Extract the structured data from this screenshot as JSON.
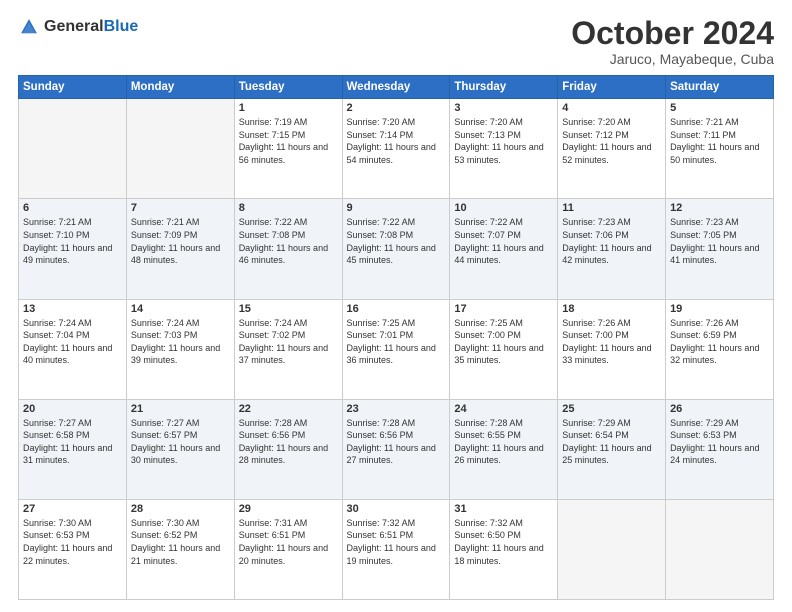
{
  "logo": {
    "general": "General",
    "blue": "Blue"
  },
  "title": "October 2024",
  "location": "Jaruco, Mayabeque, Cuba",
  "weekdays": [
    "Sunday",
    "Monday",
    "Tuesday",
    "Wednesday",
    "Thursday",
    "Friday",
    "Saturday"
  ],
  "weeks": [
    [
      {
        "day": "",
        "sunrise": "",
        "sunset": "",
        "daylight": ""
      },
      {
        "day": "",
        "sunrise": "",
        "sunset": "",
        "daylight": ""
      },
      {
        "day": "1",
        "sunrise": "Sunrise: 7:19 AM",
        "sunset": "Sunset: 7:15 PM",
        "daylight": "Daylight: 11 hours and 56 minutes."
      },
      {
        "day": "2",
        "sunrise": "Sunrise: 7:20 AM",
        "sunset": "Sunset: 7:14 PM",
        "daylight": "Daylight: 11 hours and 54 minutes."
      },
      {
        "day": "3",
        "sunrise": "Sunrise: 7:20 AM",
        "sunset": "Sunset: 7:13 PM",
        "daylight": "Daylight: 11 hours and 53 minutes."
      },
      {
        "day": "4",
        "sunrise": "Sunrise: 7:20 AM",
        "sunset": "Sunset: 7:12 PM",
        "daylight": "Daylight: 11 hours and 52 minutes."
      },
      {
        "day": "5",
        "sunrise": "Sunrise: 7:21 AM",
        "sunset": "Sunset: 7:11 PM",
        "daylight": "Daylight: 11 hours and 50 minutes."
      }
    ],
    [
      {
        "day": "6",
        "sunrise": "Sunrise: 7:21 AM",
        "sunset": "Sunset: 7:10 PM",
        "daylight": "Daylight: 11 hours and 49 minutes."
      },
      {
        "day": "7",
        "sunrise": "Sunrise: 7:21 AM",
        "sunset": "Sunset: 7:09 PM",
        "daylight": "Daylight: 11 hours and 48 minutes."
      },
      {
        "day": "8",
        "sunrise": "Sunrise: 7:22 AM",
        "sunset": "Sunset: 7:08 PM",
        "daylight": "Daylight: 11 hours and 46 minutes."
      },
      {
        "day": "9",
        "sunrise": "Sunrise: 7:22 AM",
        "sunset": "Sunset: 7:08 PM",
        "daylight": "Daylight: 11 hours and 45 minutes."
      },
      {
        "day": "10",
        "sunrise": "Sunrise: 7:22 AM",
        "sunset": "Sunset: 7:07 PM",
        "daylight": "Daylight: 11 hours and 44 minutes."
      },
      {
        "day": "11",
        "sunrise": "Sunrise: 7:23 AM",
        "sunset": "Sunset: 7:06 PM",
        "daylight": "Daylight: 11 hours and 42 minutes."
      },
      {
        "day": "12",
        "sunrise": "Sunrise: 7:23 AM",
        "sunset": "Sunset: 7:05 PM",
        "daylight": "Daylight: 11 hours and 41 minutes."
      }
    ],
    [
      {
        "day": "13",
        "sunrise": "Sunrise: 7:24 AM",
        "sunset": "Sunset: 7:04 PM",
        "daylight": "Daylight: 11 hours and 40 minutes."
      },
      {
        "day": "14",
        "sunrise": "Sunrise: 7:24 AM",
        "sunset": "Sunset: 7:03 PM",
        "daylight": "Daylight: 11 hours and 39 minutes."
      },
      {
        "day": "15",
        "sunrise": "Sunrise: 7:24 AM",
        "sunset": "Sunset: 7:02 PM",
        "daylight": "Daylight: 11 hours and 37 minutes."
      },
      {
        "day": "16",
        "sunrise": "Sunrise: 7:25 AM",
        "sunset": "Sunset: 7:01 PM",
        "daylight": "Daylight: 11 hours and 36 minutes."
      },
      {
        "day": "17",
        "sunrise": "Sunrise: 7:25 AM",
        "sunset": "Sunset: 7:00 PM",
        "daylight": "Daylight: 11 hours and 35 minutes."
      },
      {
        "day": "18",
        "sunrise": "Sunrise: 7:26 AM",
        "sunset": "Sunset: 7:00 PM",
        "daylight": "Daylight: 11 hours and 33 minutes."
      },
      {
        "day": "19",
        "sunrise": "Sunrise: 7:26 AM",
        "sunset": "Sunset: 6:59 PM",
        "daylight": "Daylight: 11 hours and 32 minutes."
      }
    ],
    [
      {
        "day": "20",
        "sunrise": "Sunrise: 7:27 AM",
        "sunset": "Sunset: 6:58 PM",
        "daylight": "Daylight: 11 hours and 31 minutes."
      },
      {
        "day": "21",
        "sunrise": "Sunrise: 7:27 AM",
        "sunset": "Sunset: 6:57 PM",
        "daylight": "Daylight: 11 hours and 30 minutes."
      },
      {
        "day": "22",
        "sunrise": "Sunrise: 7:28 AM",
        "sunset": "Sunset: 6:56 PM",
        "daylight": "Daylight: 11 hours and 28 minutes."
      },
      {
        "day": "23",
        "sunrise": "Sunrise: 7:28 AM",
        "sunset": "Sunset: 6:56 PM",
        "daylight": "Daylight: 11 hours and 27 minutes."
      },
      {
        "day": "24",
        "sunrise": "Sunrise: 7:28 AM",
        "sunset": "Sunset: 6:55 PM",
        "daylight": "Daylight: 11 hours and 26 minutes."
      },
      {
        "day": "25",
        "sunrise": "Sunrise: 7:29 AM",
        "sunset": "Sunset: 6:54 PM",
        "daylight": "Daylight: 11 hours and 25 minutes."
      },
      {
        "day": "26",
        "sunrise": "Sunrise: 7:29 AM",
        "sunset": "Sunset: 6:53 PM",
        "daylight": "Daylight: 11 hours and 24 minutes."
      }
    ],
    [
      {
        "day": "27",
        "sunrise": "Sunrise: 7:30 AM",
        "sunset": "Sunset: 6:53 PM",
        "daylight": "Daylight: 11 hours and 22 minutes."
      },
      {
        "day": "28",
        "sunrise": "Sunrise: 7:30 AM",
        "sunset": "Sunset: 6:52 PM",
        "daylight": "Daylight: 11 hours and 21 minutes."
      },
      {
        "day": "29",
        "sunrise": "Sunrise: 7:31 AM",
        "sunset": "Sunset: 6:51 PM",
        "daylight": "Daylight: 11 hours and 20 minutes."
      },
      {
        "day": "30",
        "sunrise": "Sunrise: 7:32 AM",
        "sunset": "Sunset: 6:51 PM",
        "daylight": "Daylight: 11 hours and 19 minutes."
      },
      {
        "day": "31",
        "sunrise": "Sunrise: 7:32 AM",
        "sunset": "Sunset: 6:50 PM",
        "daylight": "Daylight: 11 hours and 18 minutes."
      },
      {
        "day": "",
        "sunrise": "",
        "sunset": "",
        "daylight": ""
      },
      {
        "day": "",
        "sunrise": "",
        "sunset": "",
        "daylight": ""
      }
    ]
  ]
}
